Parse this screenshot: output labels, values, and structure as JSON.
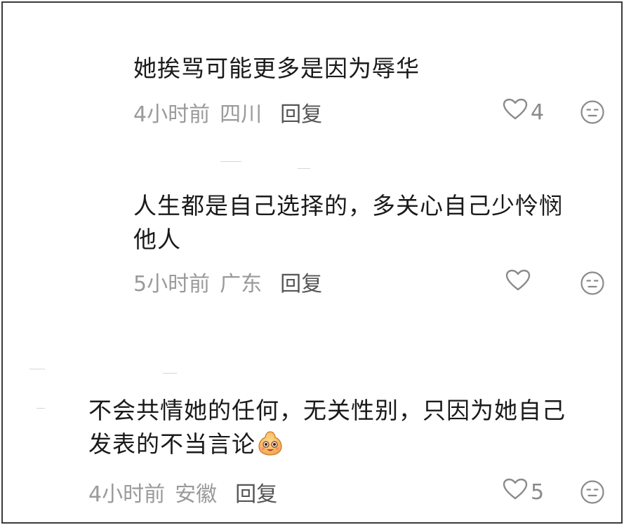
{
  "comments": [
    {
      "text": "她挨骂可能更多是因为辱华",
      "time": "4小时前",
      "location": "四川",
      "reply": "回复",
      "likes": "4"
    },
    {
      "text_line1": "人生都是自己选择的，多关心自己少怜悯",
      "text_line2": "他人",
      "time": "5小时前",
      "location": "广东",
      "reply": "回复",
      "likes": ""
    },
    {
      "text_line1": "不会共情她的任何，无关性别，只因为她自己",
      "text_line2": "发表的不当言论",
      "emoji": "smiling-bean-emoji",
      "time": "4小时前",
      "location": "安徽",
      "reply": "回复",
      "likes": "5"
    }
  ],
  "icons": {
    "like": "heart-outline-icon",
    "dislike": "neutral-face-icon"
  },
  "colors": {
    "text": "#1a1a1a",
    "meta": "#9a9a9a",
    "reply": "#555555",
    "icon": "#8a8a8a",
    "border": "#3a3a3a"
  }
}
